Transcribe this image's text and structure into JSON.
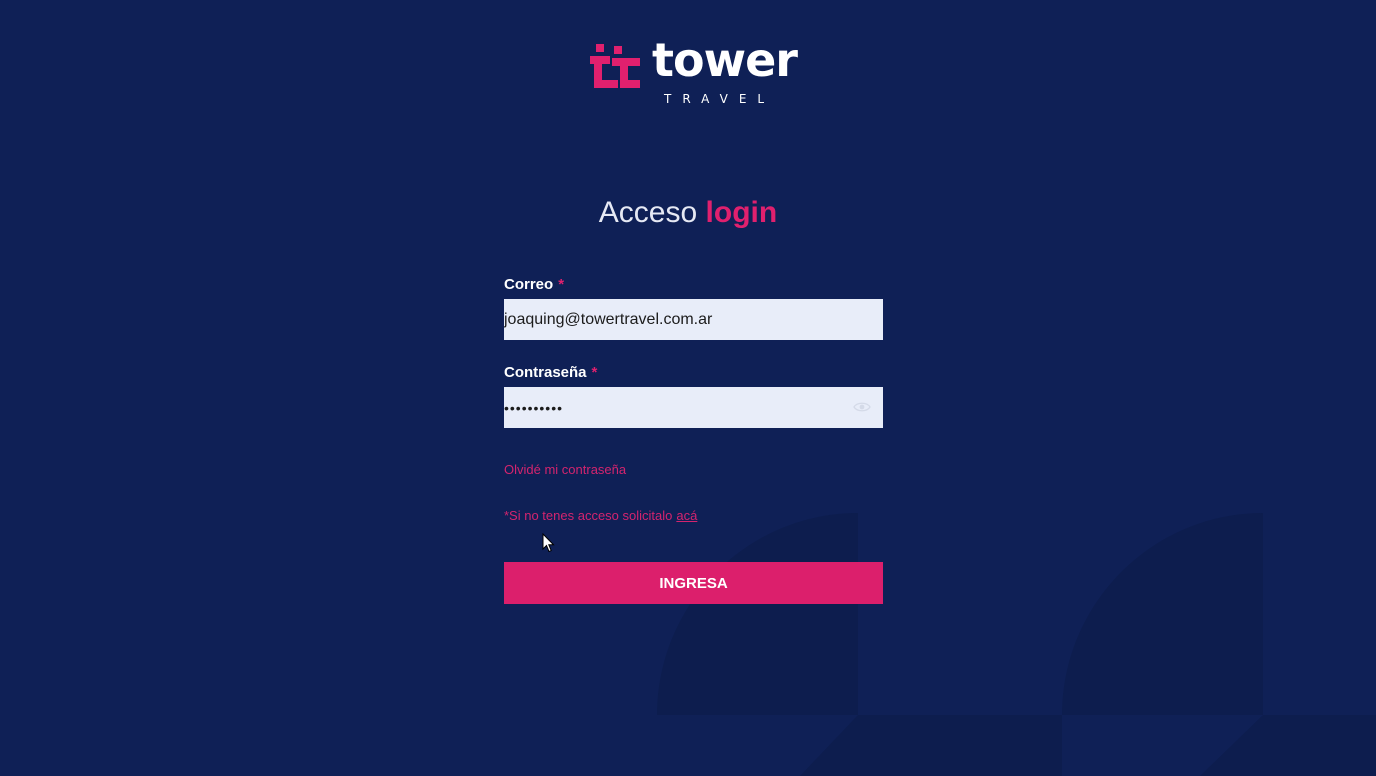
{
  "brand": {
    "name": "tower",
    "tagline": "TRAVEL",
    "accent_color": "#e0206e",
    "background_color": "#0f2056"
  },
  "heading": {
    "text": "Acceso",
    "highlight": "login"
  },
  "form": {
    "email": {
      "label": "Correo",
      "required_mark": "*",
      "value": "joaquing@towertravel.com.ar"
    },
    "password": {
      "label": "Contraseña",
      "required_mark": "*",
      "value": "••••••••••",
      "toggle_icon": "eye-icon"
    },
    "forgot_link": "Olvidé mi contraseña",
    "request_access": {
      "text": "*Si no tenes acceso solicitalo",
      "link": "acá"
    },
    "submit_label": "INGRESA"
  }
}
